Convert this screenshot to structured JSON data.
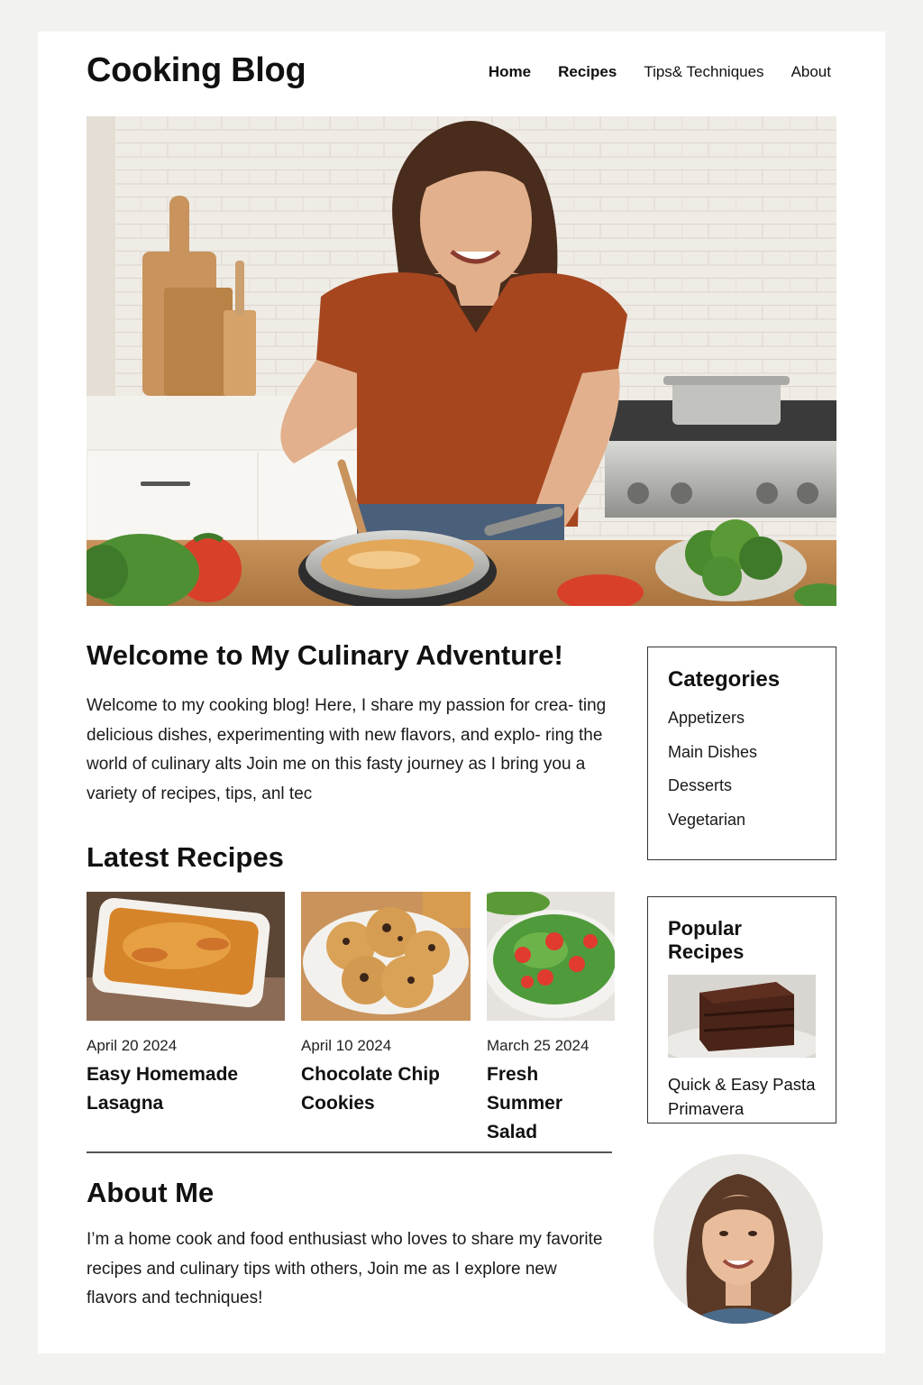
{
  "site": {
    "title": "Cooking Blog"
  },
  "nav": {
    "items": [
      "Home",
      "Recipes",
      "Tips& Techniques",
      "About"
    ]
  },
  "welcome": {
    "title": "Welcome to My Culinary Adventure!",
    "text": "Welcome to my cooking blog! Here, I share my passion for crea- ting delicious dishes, experimenting with new flavors, and explo- ring the world of culinary alts Join me on this fasty journey as I bring you a variety of recipes, tips, anl tec"
  },
  "categories": {
    "title": "Categories",
    "items": [
      "Appetizers",
      "Main Dishes",
      "Desserts",
      "Vegetarian"
    ]
  },
  "latest": {
    "title": "Latest Recipes",
    "cards": [
      {
        "date": "April 20 2024",
        "title": "Easy Homemade Lasagna"
      },
      {
        "date": "April 10 2024",
        "title": "Chocolate Chip Cookies"
      },
      {
        "date": "March 25 2024",
        "title": "Fresh Summer Salad"
      }
    ]
  },
  "popular": {
    "title": "Popular Recipes",
    "item": "Quick & Easy Pasta Primavera"
  },
  "about": {
    "title": "About Me",
    "text": "I’m a home cook and food enthusiast who loves to share my favorite recipes and culinary tips with others, Join me as I explore new flavors and techniques!"
  },
  "colors": {
    "accent": "#a6461f",
    "text": "#111111",
    "page_bg": "#f2f2f0"
  }
}
